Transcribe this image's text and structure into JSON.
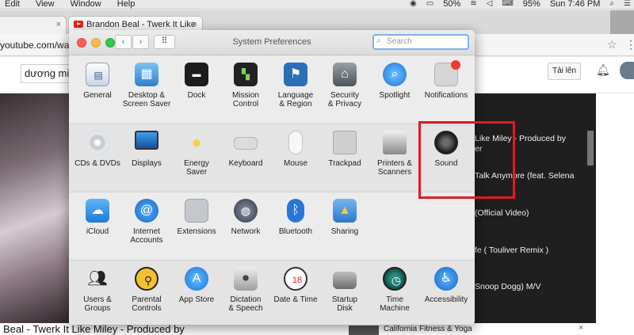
{
  "menubar": {
    "items": [
      "Edit",
      "View",
      "Window",
      "Help"
    ],
    "battery": "50%",
    "battery2": "95%",
    "clock": "Sun 7:46 PM"
  },
  "browser": {
    "tab_title": "Brandon Beal - Twerk It Like",
    "url": "youtube.com/wat"
  },
  "youtube": {
    "search_value": "dương min",
    "upload_label": "Tải lên",
    "recommendations": [
      "Like Miley - Produced by",
      "er",
      "Talk Anymore (feat. Selena",
      "(Official Video)",
      "fe ( Touliver Remix )",
      "Snoop Dogg) M/V"
    ],
    "bottom_title": "Beal - Twerk It Like Miley - Produced by",
    "bottom_rec": "California Fitness & Yoga"
  },
  "syspref": {
    "title": "System Preferences",
    "search_placeholder": "Search",
    "row1": [
      "General",
      "Desktop &\nScreen Saver",
      "Dock",
      "Mission\nControl",
      "Language\n& Region",
      "Security\n& Privacy",
      "Spotlight",
      "Notifications"
    ],
    "row2": [
      "CDs & DVDs",
      "Displays",
      "Energy\nSaver",
      "Keyboard",
      "Mouse",
      "Trackpad",
      "Printers &\nScanners",
      "Sound"
    ],
    "row3": [
      "iCloud",
      "Internet\nAccounts",
      "Extensions",
      "Network",
      "Bluetooth",
      "Sharing"
    ],
    "row4": [
      "Users &\nGroups",
      "Parental\nControls",
      "App Store",
      "Dictation\n& Speech",
      "Date & Time",
      "Startup\nDisk",
      "Time\nMachine",
      "Accessibility"
    ]
  }
}
